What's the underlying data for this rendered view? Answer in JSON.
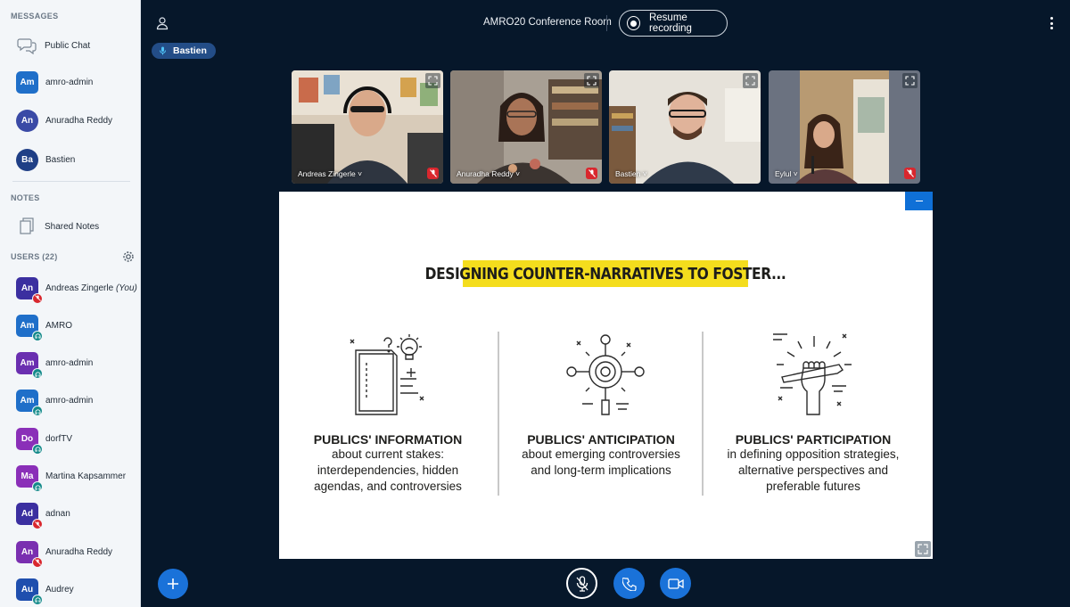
{
  "sidebar": {
    "messages_title": "MESSAGES",
    "public_chat": "Public Chat",
    "chats": [
      {
        "initials": "Am",
        "name": "amro-admin",
        "color": "#1f6fc9"
      },
      {
        "initials": "An",
        "name": "Anuradha Reddy",
        "color": "#3a4aa6"
      },
      {
        "initials": "Ba",
        "name": "Bastien",
        "color": "#1f3f86"
      }
    ],
    "notes_title": "NOTES",
    "shared_notes": "Shared Notes",
    "users_title": "USERS (22)",
    "users": [
      {
        "initials": "An",
        "name": "Andreas Zingerle",
        "you": "(You)",
        "color": "#3b2fa0",
        "status": "muted"
      },
      {
        "initials": "Am",
        "name": "AMRO",
        "color": "#1f6fc9",
        "status": "listen"
      },
      {
        "initials": "Am",
        "name": "amro-admin",
        "color": "#6a2fb0",
        "status": "listen"
      },
      {
        "initials": "Am",
        "name": "amro-admin",
        "color": "#1f6fc9",
        "status": "listen"
      },
      {
        "initials": "Do",
        "name": "dorfTV",
        "color": "#8a2fb8",
        "status": "listen"
      },
      {
        "initials": "Ma",
        "name": "Martina Kapsammer",
        "color": "#8a2fb8",
        "status": "listen"
      },
      {
        "initials": "Ad",
        "name": "adnan",
        "color": "#3b2fa0",
        "status": "muted"
      },
      {
        "initials": "An",
        "name": "Anuradha Reddy",
        "color": "#7a2fb0",
        "status": "muted"
      },
      {
        "initials": "Au",
        "name": "Audrey",
        "color": "#1f4fae",
        "status": "listen"
      }
    ]
  },
  "topbar": {
    "room_title": "AMRO20 Conference Room",
    "resume_recording": "Resume recording"
  },
  "talking": "Bastien",
  "videos": [
    {
      "name": "Andreas Zingerle"
    },
    {
      "name": "Anuradha Reddy"
    },
    {
      "name": "Bastien"
    },
    {
      "name": "Eylul"
    }
  ],
  "slide": {
    "title": "DESIGNING COUNTER-NARRATIVES TO FOSTER...",
    "columns": [
      {
        "heading": "PUBLICS' INFORMATION",
        "lines": [
          "about current stakes:",
          "interdependencies, hidden",
          "agendas, and controversies"
        ]
      },
      {
        "heading": "PUBLICS' ANTICIPATION",
        "lines": [
          "about emerging controversies",
          "and long-term implications"
        ]
      },
      {
        "heading": "PUBLICS' PARTICIPATION",
        "lines": [
          "in defining opposition strategies,",
          "alternative perspectives and",
          "preferable futures"
        ]
      }
    ]
  },
  "colors": {
    "muted_badge": "#d9272e",
    "listen_badge": "#138a8a",
    "accent": "#1a72d9",
    "title_highlight": "#f4dd1d"
  }
}
